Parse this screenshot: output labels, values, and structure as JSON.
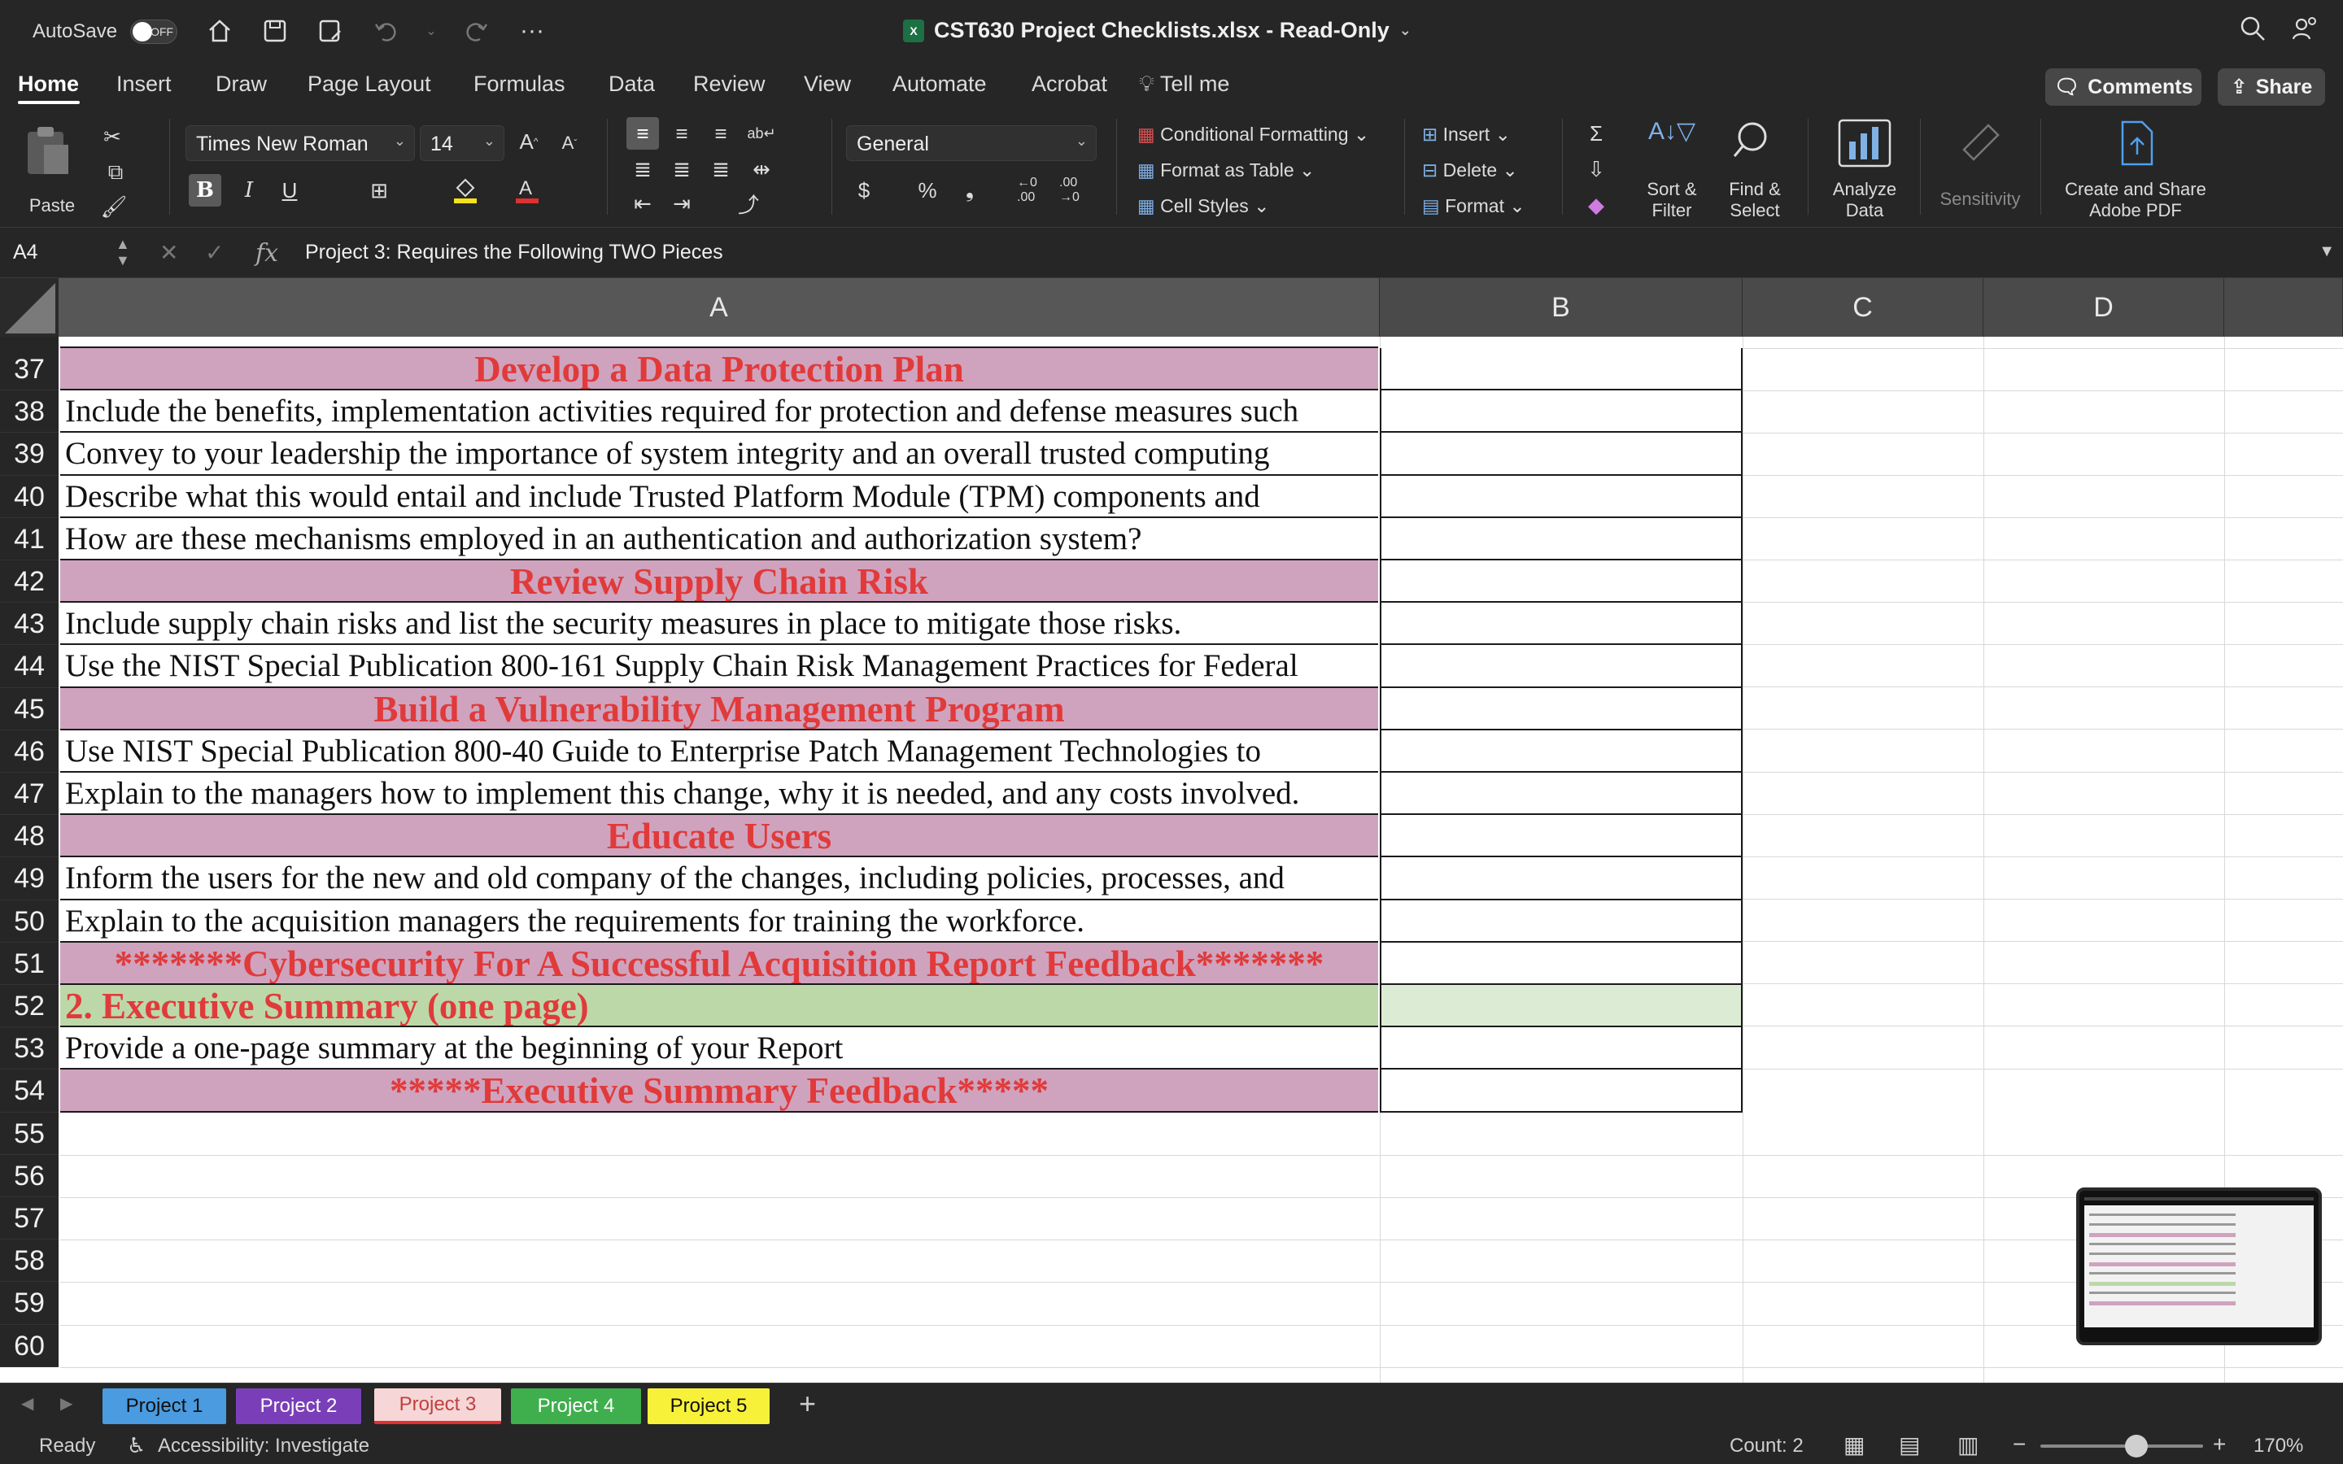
{
  "titlebar": {
    "autosave_label": "AutoSave",
    "autosave_state": "OFF",
    "document_title": "CST630 Project Checklists.xlsx  -  Read-Only",
    "more": "···"
  },
  "menu": {
    "items": [
      "Home",
      "Insert",
      "Draw",
      "Page Layout",
      "Formulas",
      "Data",
      "Review",
      "View",
      "Automate",
      "Acrobat",
      "Tell me"
    ],
    "comments": "Comments",
    "share": "Share"
  },
  "ribbon": {
    "paste": "Paste",
    "font_name": "Times New Roman",
    "font_size": "14",
    "number_format": "General",
    "conditional_formatting": "Conditional Formatting",
    "format_as_table": "Format as Table",
    "cell_styles": "Cell Styles",
    "insert": "Insert",
    "delete": "Delete",
    "format": "Format",
    "sort_filter_1": "Sort &",
    "sort_filter_2": "Filter",
    "find_select_1": "Find &",
    "find_select_2": "Select",
    "analyze_1": "Analyze",
    "analyze_2": "Data",
    "sensitivity": "Sensitivity",
    "create_share_1": "Create and Share",
    "create_share_2": "Adobe PDF",
    "bold": "B",
    "italic": "I",
    "underline": "U",
    "currency": "$",
    "percent": "%",
    "comma": "❟",
    "dec_inc": "←0 .00",
    "dec_dec": ".00 →0"
  },
  "formula_bar": {
    "name_box": "A4",
    "fx": "fx",
    "content": "Project 3: Requires the Following TWO Pieces"
  },
  "columns": [
    "A",
    "B",
    "C",
    "D"
  ],
  "rows": [
    {
      "num": "37",
      "text": "Develop a Data Protection Plan",
      "style": "head"
    },
    {
      "num": "38",
      "text": "Include the benefits, implementation activities required for protection and defense measures such",
      "style": "plain"
    },
    {
      "num": "39",
      "text": "Convey to your leadership the importance of system integrity and an overall trusted computing",
      "style": "plain"
    },
    {
      "num": "40",
      "text": " Describe what this would entail and include Trusted Platform Module (TPM) components and",
      "style": "plain"
    },
    {
      "num": "41",
      "text": "How are these mechanisms employed in an authentication and authorization system?",
      "style": "plain"
    },
    {
      "num": "42",
      "text": "Review Supply Chain Risk",
      "style": "head"
    },
    {
      "num": "43",
      "text": "Include supply chain risks and list the security measures in place to mitigate those risks.",
      "style": "plain"
    },
    {
      "num": "44",
      "text": "Use the NIST Special Publication 800-161 Supply Chain Risk Management Practices for Federal",
      "style": "plain"
    },
    {
      "num": "45",
      "text": "Build a Vulnerability Management Program",
      "style": "head"
    },
    {
      "num": "46",
      "text": "Use NIST Special Publication 800-40 Guide to Enterprise Patch Management Technologies to",
      "style": "plain"
    },
    {
      "num": "47",
      "text": "Explain to the managers how to implement this change, why it is needed, and any costs involved.",
      "style": "plain"
    },
    {
      "num": "48",
      "text": "Educate Users",
      "style": "head"
    },
    {
      "num": "49",
      "text": "Inform the users for the new and old company of the changes, including policies, processes, and",
      "style": "plain"
    },
    {
      "num": "50",
      "text": "Explain to the acquisition managers the requirements for training the workforce.",
      "style": "plain"
    },
    {
      "num": "51",
      "text": "*******Cybersecurity For A Successful Acquisition Report Feedback*******",
      "style": "head"
    },
    {
      "num": "52",
      "text": "2. Executive Summary (one page)",
      "style": "green"
    },
    {
      "num": "53",
      "text": "Provide a one-page summary at the beginning of your Report",
      "style": "plain"
    },
    {
      "num": "54",
      "text": "*****Executive Summary Feedback*****",
      "style": "head"
    },
    {
      "num": "55",
      "text": "",
      "style": "empty"
    },
    {
      "num": "56",
      "text": "",
      "style": "empty"
    },
    {
      "num": "57",
      "text": "",
      "style": "empty"
    },
    {
      "num": "58",
      "text": "",
      "style": "empty"
    },
    {
      "num": "59",
      "text": "",
      "style": "empty"
    },
    {
      "num": "60",
      "text": "",
      "style": "empty"
    }
  ],
  "sheet_tabs": [
    {
      "label": "Project 1",
      "bg": "#4a9be0",
      "fg": "#101010"
    },
    {
      "label": "Project 2",
      "bg": "#7a3fb8",
      "fg": "#ffffff"
    },
    {
      "label": "Project 3",
      "bg": "#f6d6d6",
      "fg": "#c04040",
      "active": true
    },
    {
      "label": "Project 4",
      "bg": "#3fae4c",
      "fg": "#ffffff"
    },
    {
      "label": "Project 5",
      "bg": "#f7f13a",
      "fg": "#101010"
    }
  ],
  "add_sheet": "+",
  "status": {
    "ready": "Ready",
    "accessibility": "Accessibility: Investigate",
    "count": "Count: 2",
    "zoom": "170%",
    "minus": "−",
    "plus": "+"
  },
  "colors": {
    "header_fill": "#cfa3be",
    "header_text": "#e13a3a",
    "green_fill": "#bcd8a9"
  }
}
